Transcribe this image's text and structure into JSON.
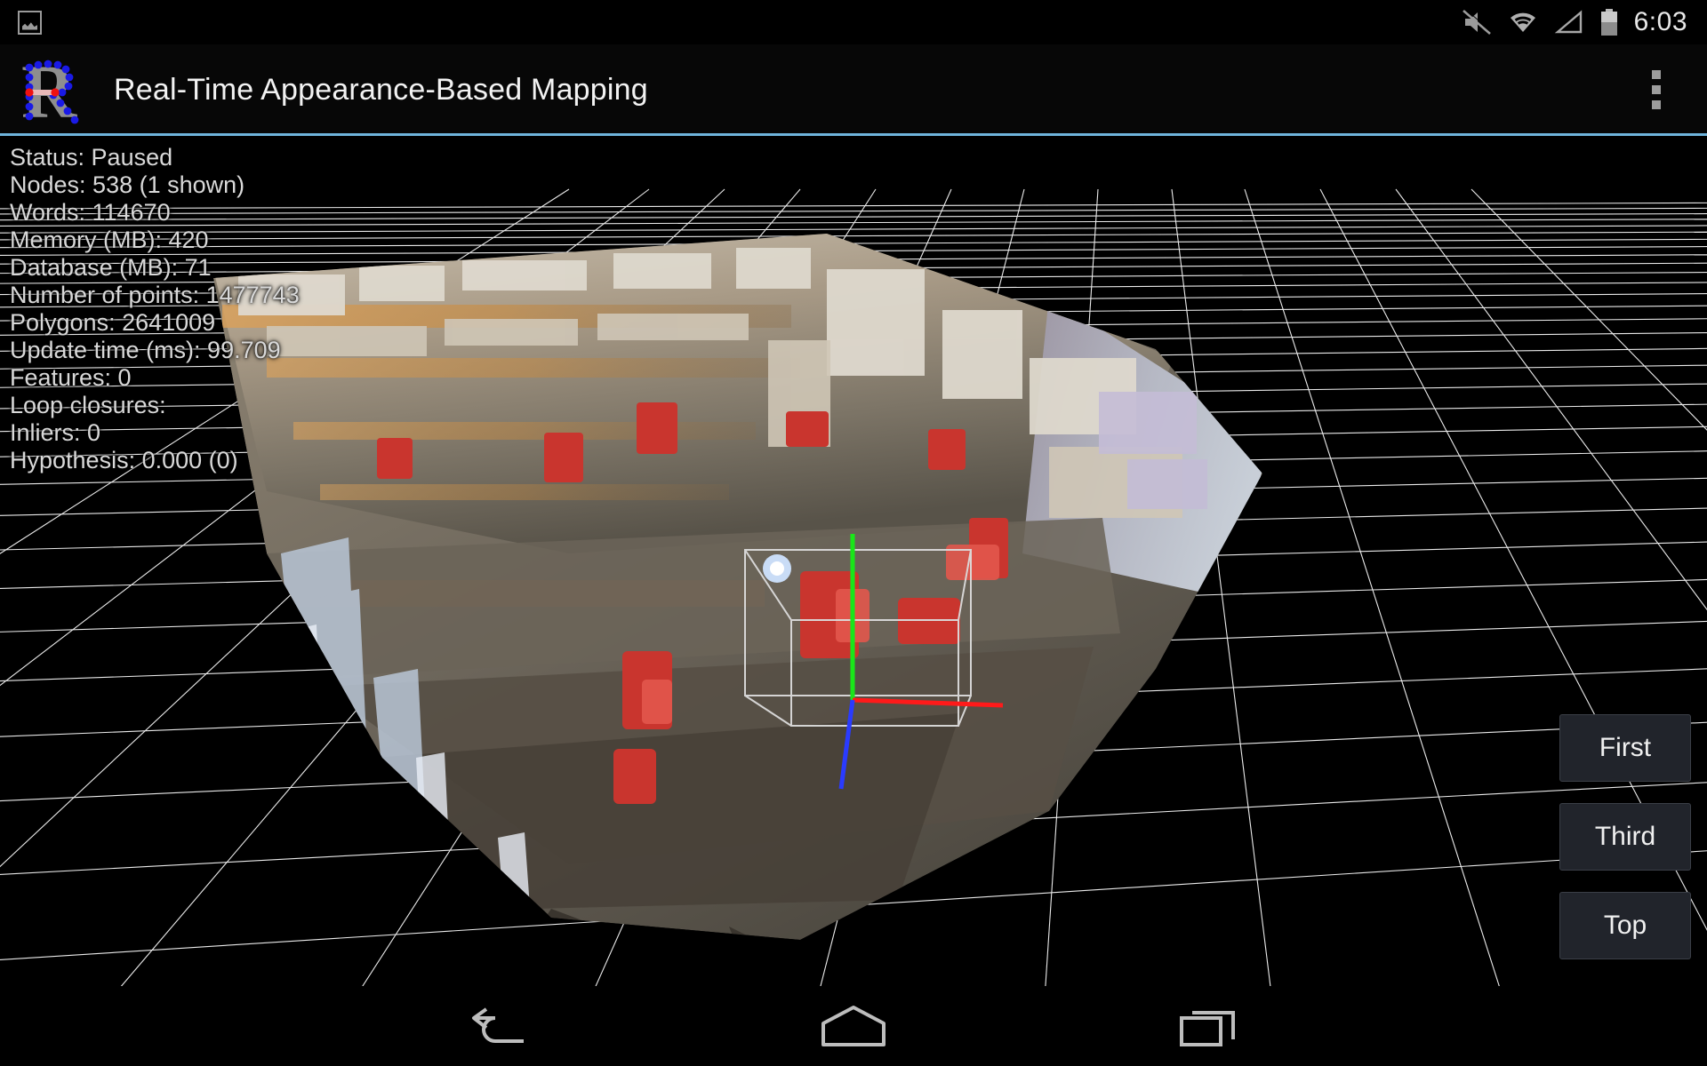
{
  "status_bar": {
    "notification_icon": "photo-icon",
    "icons": [
      "mute-icon",
      "wifi-icon",
      "cell-signal-icon",
      "battery-icon"
    ],
    "clock": "6:03"
  },
  "title_bar": {
    "logo": "rtabmap-r-logo",
    "title": "Real-Time Appearance-Based Mapping",
    "overflow_menu": "overflow-menu-icon",
    "accent_color": "#6fb4dc"
  },
  "overlay_stats": [
    "Status: Paused",
    "Nodes: 538 (1 shown)",
    "Words: 114670",
    "Memory (MB): 420",
    "Database (MB): 71",
    "Number of points: 1477743",
    "Polygons: 2641009",
    "Update time (ms): 99.709",
    "Features: 0",
    "Loop closures:",
    "Inliers: 0",
    "Hypothesis: 0.000 (0)"
  ],
  "view_buttons": [
    {
      "label": "First",
      "name": "first-person-view-button"
    },
    {
      "label": "Third",
      "name": "third-person-view-button"
    },
    {
      "label": "Top",
      "name": "top-view-button"
    }
  ],
  "nav_bar": {
    "back": "back-icon",
    "home": "home-icon",
    "recents": "recents-icon"
  },
  "scene": {
    "description": "3D textured mesh of an indoor office reconstructed by RTAB-Map, floating over a white wireframe ground grid on black background",
    "axis_colors": {
      "x": "#ff1a1a",
      "y": "#19e619",
      "z": "#2a3bff"
    },
    "grid_color": "#ffffff"
  }
}
